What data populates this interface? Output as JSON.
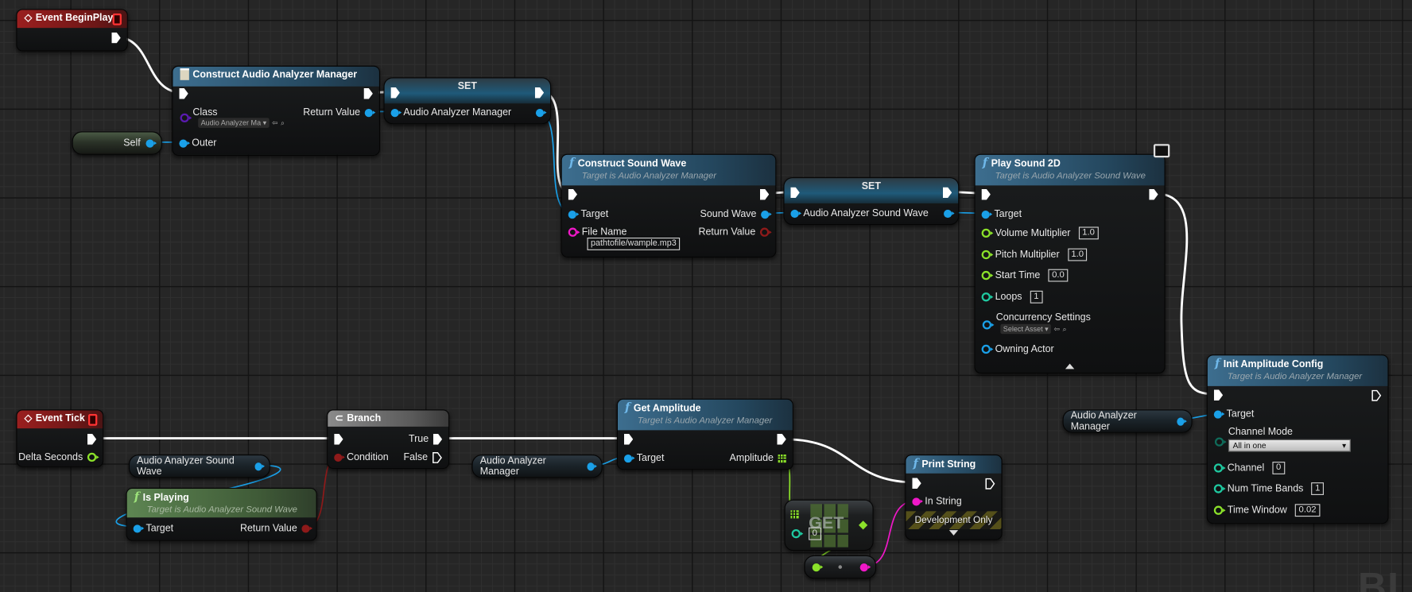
{
  "colors": {
    "exec": "#ffffff",
    "object": "#1aa0e8",
    "class": "#5a1ab0",
    "string": "#f018c8",
    "float": "#8be12a",
    "int": "#1fc9a0",
    "bool": "#8e1a1a",
    "byte": "#0f6b5a",
    "event_header": "#9a1f1f",
    "function_header": "#3d6e8f",
    "pure_header": "#5d8552"
  },
  "watermark": "BLUEPRINT",
  "nodes": {
    "begin_play": {
      "title": "Event BeginPlay",
      "icon": "event-diamond-icon"
    },
    "construct_manager": {
      "title": "Construct Audio Analyzer Manager",
      "icon": "class-icon",
      "class_label": "Class",
      "class_value": "Audio Analyzer Ma",
      "return_label": "Return Value",
      "outer_label": "Outer"
    },
    "self": {
      "label": "Self"
    },
    "set_manager": {
      "title": "SET",
      "var_label": "Audio Analyzer Manager"
    },
    "construct_sound_wave": {
      "title": "Construct Sound Wave",
      "subtitle": "Target is Audio Analyzer Manager",
      "target_label": "Target",
      "sound_wave_label": "Sound Wave",
      "file_name_label": "File Name",
      "file_name_value": "pathtofile/wample.mp3",
      "return_label": "Return Value"
    },
    "set_sound_wave": {
      "title": "SET",
      "var_label": "Audio Analyzer Sound Wave"
    },
    "play_sound_2d": {
      "title": "Play Sound 2D",
      "subtitle": "Target is Audio Analyzer Sound Wave",
      "target_label": "Target",
      "volume_label": "Volume Multiplier",
      "volume_value": "1.0",
      "pitch_label": "Pitch Multiplier",
      "pitch_value": "1.0",
      "start_label": "Start Time",
      "start_value": "0.0",
      "loops_label": "Loops",
      "loops_value": "1",
      "concurrency_label": "Concurrency Settings",
      "concurrency_value": "Select Asset",
      "owning_label": "Owning Actor",
      "icon": "client-only-icon"
    },
    "init_amplitude": {
      "title": "Init Amplitude Config",
      "subtitle": "Target is Audio Analyzer Manager",
      "target_label": "Target",
      "channel_mode_label": "Channel Mode",
      "channel_mode_value": "All in one",
      "channel_label": "Channel",
      "channel_value": "0",
      "bands_label": "Num Time Bands",
      "bands_value": "1",
      "window_label": "Time Window",
      "window_value": "0.02"
    },
    "manager_getter_right": {
      "label": "Audio Analyzer Manager"
    },
    "event_tick": {
      "title": "Event Tick",
      "delta_label": "Delta Seconds"
    },
    "branch": {
      "title": "Branch",
      "condition_label": "Condition",
      "true_label": "True",
      "false_label": "False"
    },
    "sound_wave_getter": {
      "label": "Audio Analyzer Sound Wave"
    },
    "is_playing": {
      "title": "Is Playing",
      "subtitle": "Target is Audio Analyzer Sound Wave",
      "target_label": "Target",
      "return_label": "Return Value"
    },
    "manager_getter_mid": {
      "label": "Audio Analyzer Manager"
    },
    "get_amplitude": {
      "title": "Get Amplitude",
      "subtitle": "Target is Audio Analyzer Manager",
      "target_label": "Target",
      "amplitude_label": "Amplitude"
    },
    "array_get": {
      "title": "GET",
      "index_value": "0"
    },
    "print_string": {
      "title": "Print String",
      "in_string_label": "In String",
      "dev_label": "Development Only"
    }
  }
}
